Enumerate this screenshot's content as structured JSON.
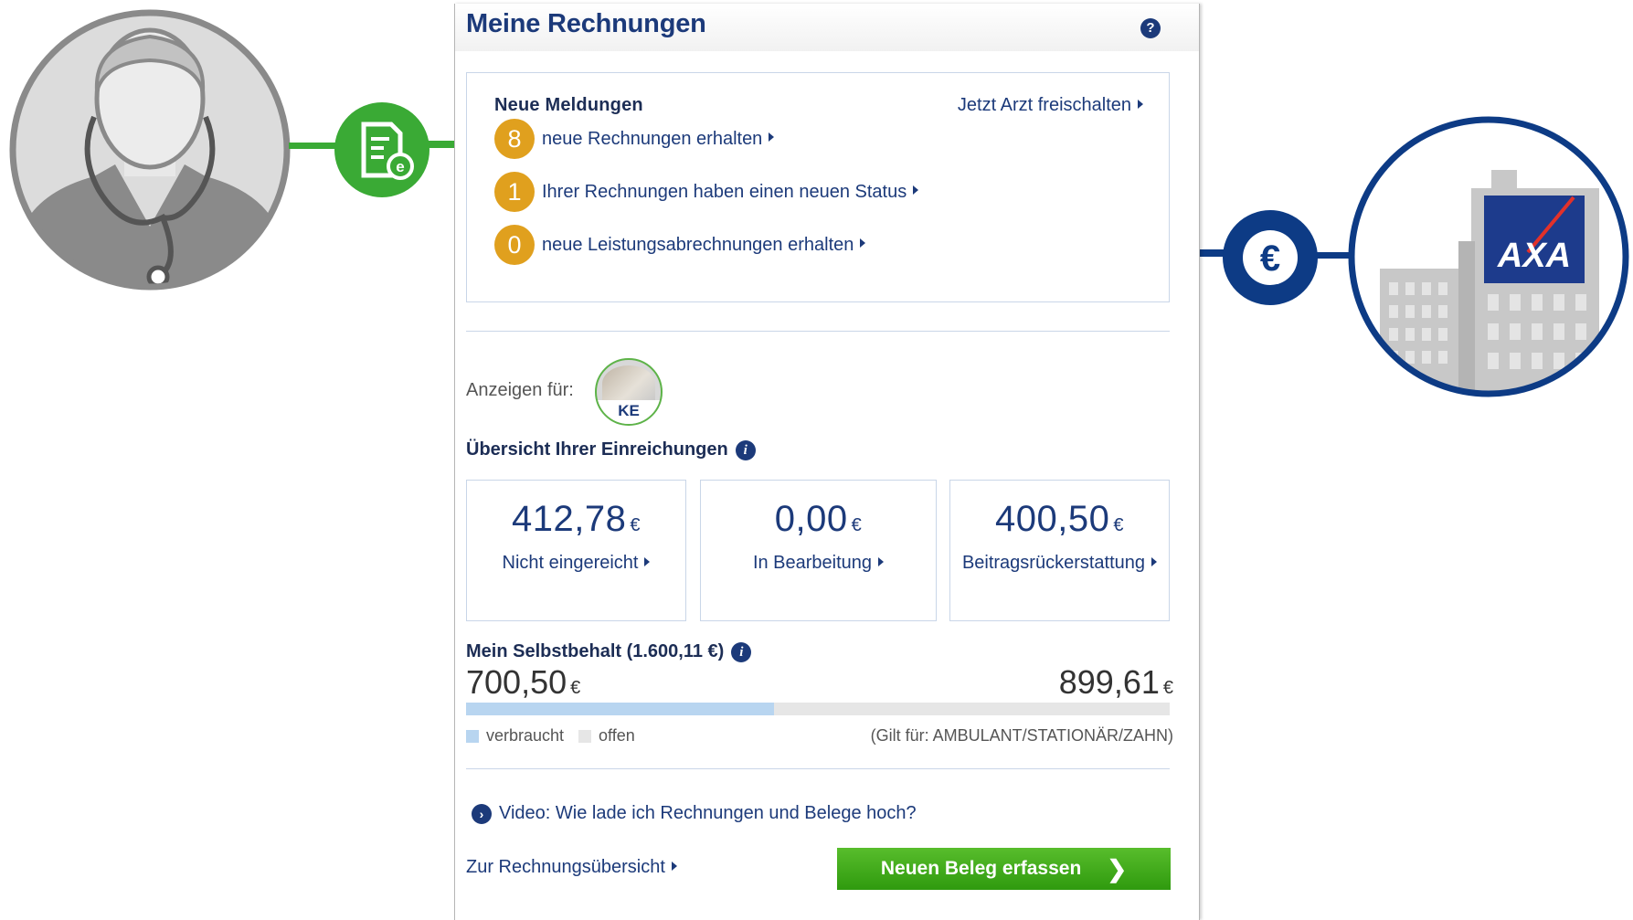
{
  "panel": {
    "title": "Meine Rechnungen",
    "help_icon": "question-icon"
  },
  "meldungen": {
    "title": "Neue Meldungen",
    "arzt_link": "Jetzt Arzt freischalten",
    "items": [
      {
        "count": "8",
        "text": "neue Rechnungen erhalten"
      },
      {
        "count": "1",
        "text": "Ihrer Rechnungen haben einen neuen Status"
      },
      {
        "count": "0",
        "text": "neue Leistungsabrechnungen erhalten"
      }
    ]
  },
  "anzeigen": {
    "label": "Anzeigen für:",
    "avatar_initials": "KE"
  },
  "einreichungen": {
    "title": "Übersicht Ihrer Einreichungen",
    "cards": [
      {
        "value": "412,78",
        "unit": "€",
        "label": "Nicht eingereicht"
      },
      {
        "value": "0,00",
        "unit": "€",
        "label": "In Bearbeitung"
      },
      {
        "value": "400,50",
        "unit": "€",
        "label": "Beitragsrückerstattung"
      }
    ]
  },
  "selbstbehalt": {
    "title": "Mein Selbstbehalt (1.600,11 €)",
    "used": "700,50",
    "open": "899,61",
    "unit": "€",
    "used_fraction": 0.4378,
    "legend_used": "verbraucht",
    "legend_open": "offen",
    "gilt": "(Gilt für: AMBULANT/STATIONÄR/ZAHN)"
  },
  "links": {
    "video": "Video: Wie lade ich Rechnungen und Belege hoch?",
    "uebersicht": "Zur Rechnungsübersicht"
  },
  "button": {
    "label": "Neuen Beleg erfassen"
  },
  "illustrations": {
    "insurer_logo": "AXA",
    "doc_badge_icon": "e-invoice-icon",
    "euro_badge_icon": "euro-icon"
  },
  "colors": {
    "brand_blue": "#1c3a7a",
    "axa_blue": "#0d3b85",
    "badge_orange": "#e0a01e",
    "green": "#3aaa35"
  }
}
